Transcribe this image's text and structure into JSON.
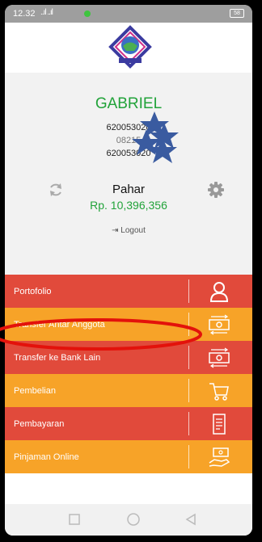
{
  "status_bar": {
    "time": "12.32",
    "signal": "..ıl ..ıl",
    "battery": "58"
  },
  "profile": {
    "name": "GABRIEL",
    "id_line_1": "620053020",
    "id_line_2": "08215",
    "id_line_3": "620053020",
    "secondary_name": "Pahar",
    "balance": "Rp. 10,396,356",
    "logout_label": "Logout"
  },
  "menu": {
    "items": [
      {
        "label": "Portofolio",
        "color": "#e14a3b",
        "icon": "user-icon"
      },
      {
        "label": "Transfer Antar Anggota",
        "color": "#f7a328",
        "icon": "money-transfer-icon"
      },
      {
        "label": "Transfer ke Bank Lain",
        "color": "#e14a3b",
        "icon": "money-transfer-icon"
      },
      {
        "label": "Pembelian",
        "color": "#f7a328",
        "icon": "cart-icon"
      },
      {
        "label": "Pembayaran",
        "color": "#e14a3b",
        "icon": "receipt-icon"
      },
      {
        "label": "Pinjaman Online",
        "color": "#f7a328",
        "icon": "loan-icon"
      }
    ]
  },
  "colors": {
    "accent_green": "#22a33a",
    "menu_red": "#e14a3b",
    "menu_orange": "#f7a328",
    "highlight_ellipse": "#e3120b"
  }
}
